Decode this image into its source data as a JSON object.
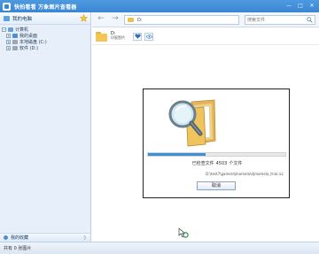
{
  "window": {
    "title": "快拍看看 万象图片查看器",
    "controls": [
      "—",
      "□",
      "✕"
    ]
  },
  "sidebar": {
    "header": "我的电脑",
    "tree": [
      {
        "label": "计算机",
        "expander": "−",
        "level": 0
      },
      {
        "label": "我的桌面",
        "expander": "+",
        "level": 1
      },
      {
        "label": "本地磁盘 (C:)",
        "expander": "+",
        "level": 1
      },
      {
        "label": "软件 (D:)",
        "expander": "+",
        "level": 1
      }
    ],
    "footer": "我的收藏",
    "footer_chevron": "◊"
  },
  "toolbar": {
    "back_icon": "←",
    "forward_icon": "→",
    "address": "D:",
    "search_placeholder": "搜索文件"
  },
  "info": {
    "folder_name": "D:",
    "count_text": "0张图片"
  },
  "dialog": {
    "progress_fraction": 0.42,
    "status_prefix": "已检查文件",
    "status_count": "4503",
    "status_suffix": "个文件",
    "current_path": "D:\\test7\\game\\djmomela\\djmomela_trial.icc",
    "cancel_label": "取消"
  },
  "statusbar": {
    "text": "共有 0 张图片"
  },
  "colors": {
    "titlebar": "#3b86d3",
    "sidebar_bg": "#e7f0fa",
    "progress_fill": "#3d8fd8",
    "folder": "#f3c552"
  }
}
